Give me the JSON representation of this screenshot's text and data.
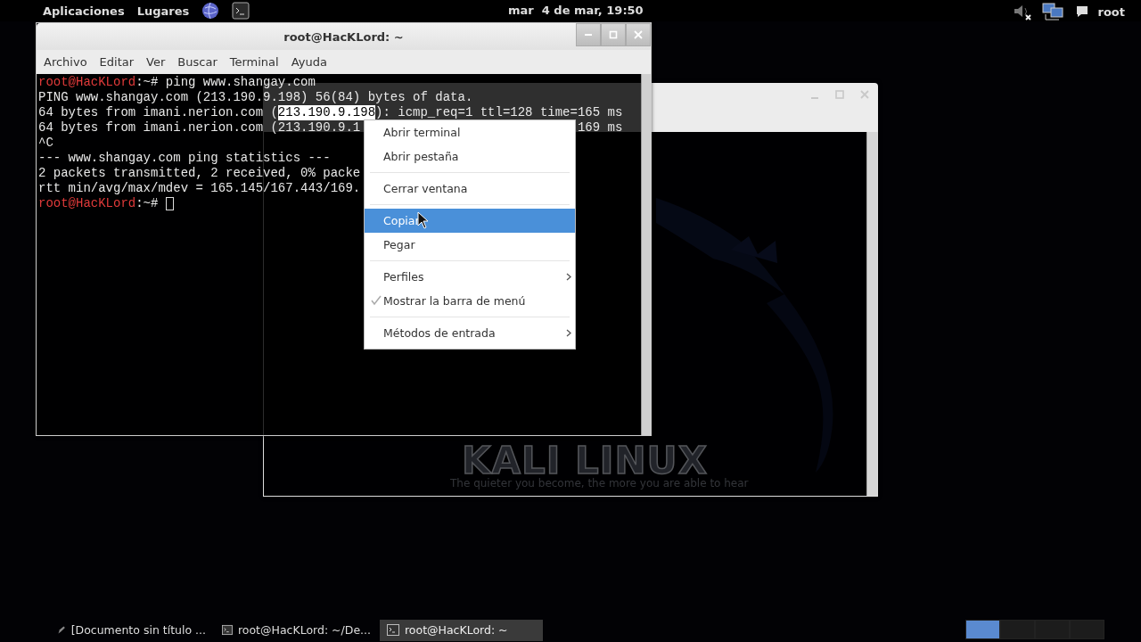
{
  "top_bar": {
    "menus": [
      "Aplicaciones",
      "Lugares"
    ],
    "clock": "mar  4 de mar, 19:50",
    "user": "root"
  },
  "wallpaper": {
    "logo": "KALI LINUX",
    "slogan": "The quieter you become, the more you are able to hear"
  },
  "terminal": {
    "title": "root@HacKLord: ~",
    "menu": [
      "Archivo",
      "Editar",
      "Ver",
      "Buscar",
      "Terminal",
      "Ayuda"
    ],
    "lines": [
      [
        {
          "kind": "prompt",
          "text": "root@HacKLord"
        },
        {
          "kind": "text",
          "text": ":~# ping www.shangay.com"
        }
      ],
      [
        {
          "kind": "text",
          "text": "PING www.shangay.com (213.190.9.198) 56(84) bytes of data."
        }
      ],
      [
        {
          "kind": "text",
          "text": "64 bytes from imani.nerion.com ("
        },
        {
          "kind": "selection",
          "text": "213.190.9.198"
        },
        {
          "kind": "text",
          "text": "): icmp_req=1 ttl=128 time=165 ms"
        }
      ],
      [
        {
          "kind": "text",
          "text": "64 bytes from imani.nerion.com (213.190.9.1"
        },
        {
          "kind": "right",
          "text": "169 ms"
        }
      ],
      [
        {
          "kind": "text",
          "text": "^C"
        }
      ],
      [
        {
          "kind": "text",
          "text": "--- www.shangay.com ping statistics ---"
        }
      ],
      [
        {
          "kind": "text",
          "text": "2 packets transmitted, 2 received, 0% packe"
        }
      ],
      [
        {
          "kind": "text",
          "text": "rtt min/avg/max/mdev = 165.145/167.443/169."
        }
      ],
      [
        {
          "kind": "prompt",
          "text": "root@HacKLord"
        },
        {
          "kind": "text",
          "text": ":~# "
        },
        {
          "kind": "cursor"
        }
      ]
    ]
  },
  "context_menu": {
    "sections": [
      [
        {
          "label": "Abrir terminal",
          "kind": "item",
          "checked": false,
          "selected": false
        },
        {
          "label": "Abrir pestaña",
          "kind": "item",
          "checked": false,
          "selected": false
        }
      ],
      [
        {
          "label": "Cerrar ventana",
          "kind": "item",
          "checked": false,
          "selected": false
        }
      ],
      [
        {
          "label": "Copiar",
          "kind": "item",
          "checked": false,
          "selected": true
        },
        {
          "label": "Pegar",
          "kind": "item",
          "checked": false,
          "selected": false
        }
      ],
      [
        {
          "label": "Perfiles",
          "kind": "submenu",
          "checked": false,
          "selected": false
        },
        {
          "label": "Mostrar la barra de menú",
          "kind": "item",
          "checked": true,
          "selected": false
        }
      ],
      [
        {
          "label": "Métodos de entrada",
          "kind": "submenu",
          "checked": false,
          "selected": false
        }
      ]
    ]
  },
  "taskbar": {
    "items": [
      {
        "label": "[Documento sin título ...",
        "kind": "document",
        "selected": false
      },
      {
        "label": "root@HacKLord: ~/De...",
        "kind": "terminal",
        "selected": false
      },
      {
        "label": "root@HacKLord: ~",
        "kind": "terminal",
        "selected": true
      }
    ],
    "workspaces": [
      {
        "selected": true
      },
      {
        "selected": false
      },
      {
        "selected": false
      },
      {
        "selected": false
      }
    ]
  }
}
